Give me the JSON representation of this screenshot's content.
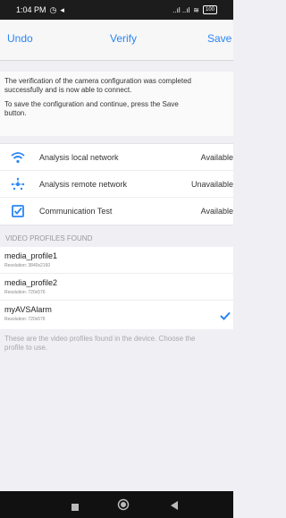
{
  "status_bar": {
    "time": "1:04 PM",
    "signal_text": "..ıl ..ıl",
    "battery": "100"
  },
  "toolbar": {
    "undo_label": "Undo",
    "verify_label": "Verify",
    "save_label": "Save"
  },
  "message": {
    "line1": "The verification of the camera configuration was completed",
    "line2": "successfully and is now able to connect.",
    "line3": "To save the configuration and continue, press the Save",
    "line4": "button."
  },
  "network_checks": [
    {
      "label": "Analysis local network",
      "status": "Available",
      "icon": "wifi-icon"
    },
    {
      "label": "Analysis remote network",
      "status": "Unavailable",
      "icon": "remote-network-icon"
    },
    {
      "label": "Communication Test",
      "status": "Available",
      "icon": "checkbox-icon"
    }
  ],
  "profiles_section": {
    "header": "VIDEO PROFILES FOUND",
    "profiles": [
      {
        "name": "media_profile1",
        "resolution": "Resolution: 3840x2160",
        "selected": false
      },
      {
        "name": "media_profile2",
        "resolution": "Resolution: 720x576",
        "selected": false
      },
      {
        "name": "myAVSAlarm",
        "resolution": "Resolution: 720x576",
        "selected": true
      }
    ],
    "footer_line1": "These are the video profiles found in the device. Choose the",
    "footer_line2": "profile to use."
  },
  "colors": {
    "accent": "#2a86f6",
    "background": "#efeff4"
  },
  "android_nav": {
    "icons": [
      "recents-icon",
      "home-icon",
      "back-icon"
    ]
  }
}
